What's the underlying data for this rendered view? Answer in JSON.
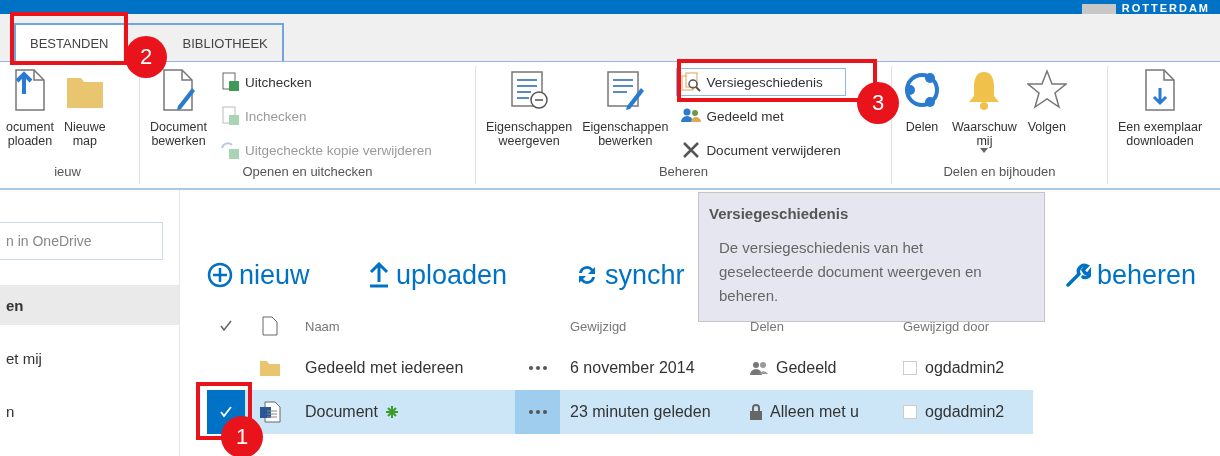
{
  "top_bar": {
    "logo_text": "ROTTERDAM"
  },
  "tabs": [
    {
      "label": "BESTANDEN",
      "selected": true
    },
    {
      "label": "BIBLIOTHEEK",
      "selected": false
    }
  ],
  "ribbon": {
    "groups": [
      {
        "label": "ieuw",
        "items": [
          {
            "kind": "large",
            "lines": [
              "ocument",
              "ploaden"
            ]
          },
          {
            "kind": "large",
            "lines": [
              "Nieuwe",
              "map"
            ]
          }
        ]
      },
      {
        "label": "Openen en uitchecken",
        "items": [
          {
            "kind": "large",
            "lines": [
              "Document",
              "bewerken"
            ]
          },
          {
            "kind": "small",
            "label": "Uitchecken",
            "disabled": false,
            "hovered": false
          },
          {
            "kind": "small",
            "label": "Inchecken",
            "disabled": true,
            "hovered": false
          },
          {
            "kind": "small",
            "label": "Uitgecheckte kopie verwijderen",
            "disabled": true,
            "hovered": false
          }
        ]
      },
      {
        "label": "Beheren",
        "items": [
          {
            "kind": "large",
            "lines": [
              "Eigenschappen",
              "weergeven"
            ]
          },
          {
            "kind": "large",
            "lines": [
              "Eigenschappen",
              "bewerken"
            ]
          },
          {
            "kind": "small",
            "label": "Versiegeschiedenis",
            "disabled": false,
            "hovered": true
          },
          {
            "kind": "small",
            "label": "Gedeeld met",
            "disabled": false,
            "hovered": false
          },
          {
            "kind": "small",
            "label": "Document verwijderen",
            "disabled": false,
            "hovered": false
          }
        ]
      },
      {
        "label": "Delen en bijhouden",
        "items": [
          {
            "kind": "large",
            "lines": [
              "Delen"
            ]
          },
          {
            "kind": "large",
            "lines": [
              "Waarschuw",
              "mij"
            ],
            "dropdown": true
          },
          {
            "kind": "large",
            "lines": [
              "Volgen"
            ]
          }
        ]
      },
      {
        "items": [
          {
            "kind": "large",
            "lines": [
              "Een exemplaar",
              "downloaden"
            ]
          }
        ]
      }
    ]
  },
  "sidebar": {
    "search": {
      "placeholder": "n in OneDrive"
    },
    "items": [
      {
        "label": "en",
        "selected": true
      },
      {
        "label": "et mij",
        "selected": false
      },
      {
        "label": "n",
        "selected": false
      }
    ]
  },
  "commands": [
    "nieuw",
    "uploaden",
    "synchr",
    "beheren"
  ],
  "table": {
    "columns": [
      "Naam",
      "Gewijzigd",
      "Delen",
      "Gewijzigd door"
    ],
    "rows": [
      {
        "kind": "folder",
        "name": "Gedeeld met iedereen",
        "new": false,
        "modified": "6 november 2014",
        "shared": true,
        "sharing": "Gedeeld",
        "modified_by": "ogdadmin2",
        "selected": false
      },
      {
        "kind": "document",
        "name": "Document",
        "new": true,
        "modified": "23 minuten geleden",
        "shared": false,
        "sharing": "Alleen met u",
        "modified_by": "ogdadmin2",
        "selected": true
      }
    ]
  },
  "tooltip": {
    "title": "Versiegeschiedenis",
    "text": "De versiegeschiedenis van het geselecteerde document weergeven en beheren."
  },
  "callouts": [
    "2",
    "3",
    "1"
  ]
}
